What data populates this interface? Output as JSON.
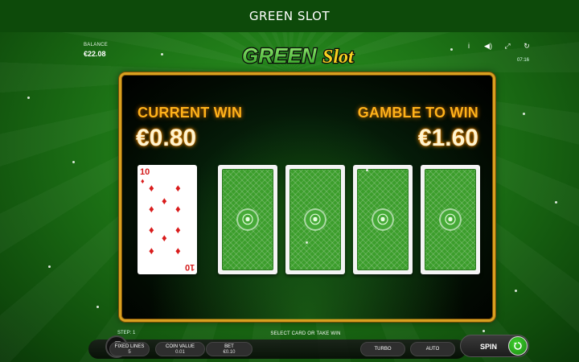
{
  "header": {
    "title": "GREEN SLOT"
  },
  "balance": {
    "label": "BALANCE",
    "value": "€22.08"
  },
  "logo": {
    "text_green": "GREEN",
    "text_slot": "Slot"
  },
  "toolbar": {
    "icons": [
      "info-icon",
      "sound-icon",
      "fullscreen-icon",
      "history-icon"
    ],
    "glyphs": [
      "i",
      "◀)",
      "⤢",
      "↻"
    ],
    "clock": "07:16"
  },
  "gamble": {
    "current_win_label": "CURRENT WIN",
    "current_win_value": "€0.80",
    "gamble_to_win_label": "GAMBLE TO WIN",
    "gamble_to_win_value": "€1.60",
    "revealed_card": {
      "rank": "10",
      "suit": "diamonds",
      "suit_glyph": "♦"
    },
    "card_back_glyph": "⦿"
  },
  "footer": {
    "step": "STEP: 1",
    "message": "SELECT CARD OR TAKE WIN",
    "fixed_lines_label": "FIXED LINES",
    "fixed_lines_value": "5",
    "coin_value_label": "COIN VALUE",
    "coin_value_value": "0.01",
    "bet_label": "BET",
    "bet_value": "€0.10",
    "turbo_label": "TURBO",
    "auto_label": "AUTO",
    "spin_label": "SPIN"
  },
  "colors": {
    "gold": "#d8a020",
    "win_label": "#ffb21a",
    "card_back": "#3c9e2c",
    "diamond": "#d91c1c"
  }
}
